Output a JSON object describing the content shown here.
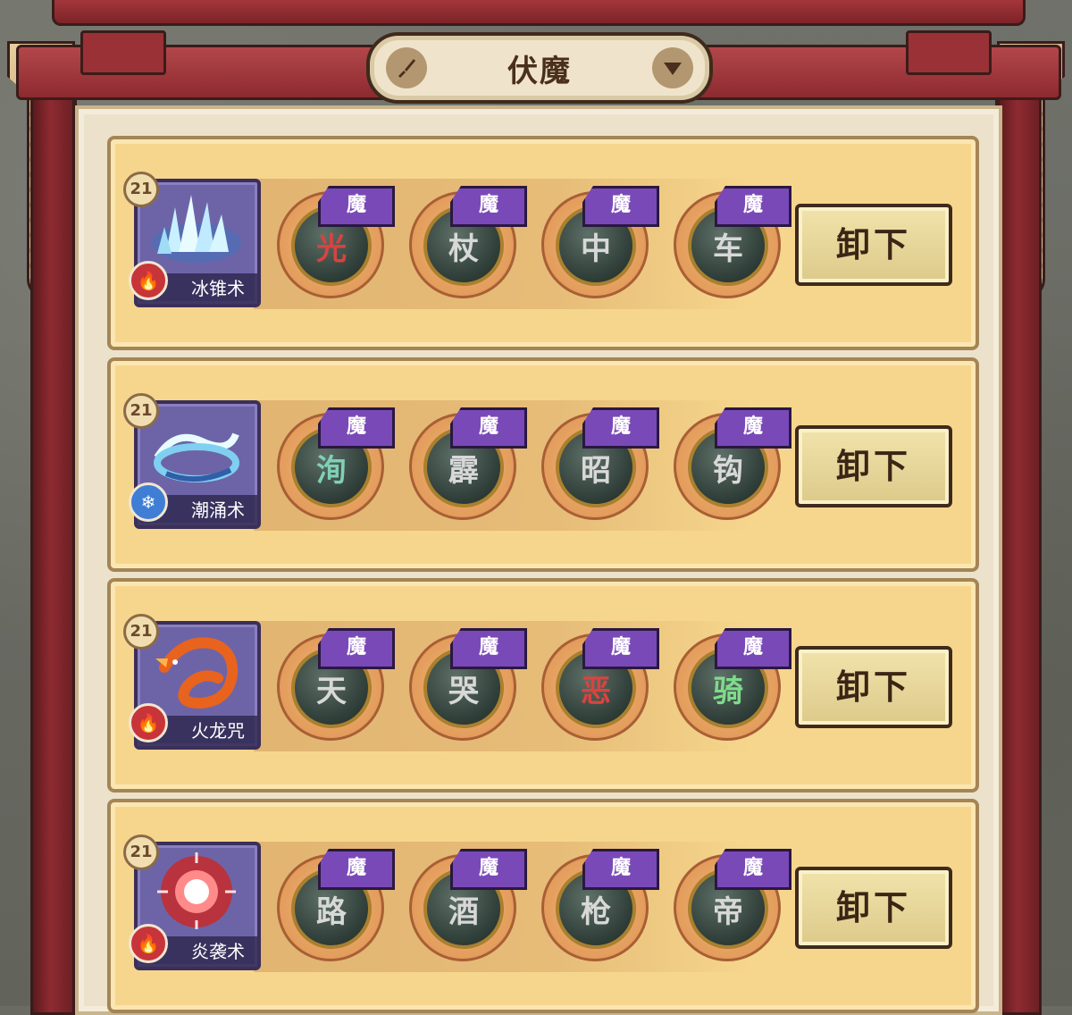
{
  "header": {
    "title": "伏魔",
    "left_icon": "brush-icon",
    "right_icon": "chevron-down-icon"
  },
  "rows": [
    {
      "skill": {
        "name": "冰锥术",
        "level": "21",
        "element": "fire",
        "art": "ice-spikes"
      },
      "runes": [
        {
          "tag": "魔",
          "char": "光",
          "color": "#d9433f"
        },
        {
          "tag": "魔",
          "char": "杖",
          "color": "#d8d8d8"
        },
        {
          "tag": "魔",
          "char": "中",
          "color": "#d8d8d8"
        },
        {
          "tag": "魔",
          "char": "车",
          "color": "#d8d8d8"
        }
      ],
      "button": "卸下"
    },
    {
      "skill": {
        "name": "潮涌术",
        "level": "21",
        "element": "ice",
        "art": "water-wave"
      },
      "runes": [
        {
          "tag": "魔",
          "char": "洵",
          "color": "#7fd1b6"
        },
        {
          "tag": "魔",
          "char": "霹",
          "color": "#d8d8d8"
        },
        {
          "tag": "魔",
          "char": "昭",
          "color": "#d8d8d8"
        },
        {
          "tag": "魔",
          "char": "钩",
          "color": "#d8d8d8"
        }
      ],
      "button": "卸下"
    },
    {
      "skill": {
        "name": "火龙咒",
        "level": "21",
        "element": "fire",
        "art": "fire-dragon"
      },
      "runes": [
        {
          "tag": "魔",
          "char": "天",
          "color": "#d8d8d8"
        },
        {
          "tag": "魔",
          "char": "哭",
          "color": "#d8d8d8"
        },
        {
          "tag": "魔",
          "char": "恶",
          "color": "#d9433f"
        },
        {
          "tag": "魔",
          "char": "骑",
          "color": "#7ddc8a"
        }
      ],
      "button": "卸下"
    },
    {
      "skill": {
        "name": "炎袭术",
        "level": "21",
        "element": "fire",
        "art": "fire-burst"
      },
      "runes": [
        {
          "tag": "魔",
          "char": "路",
          "color": "#d8d8d8"
        },
        {
          "tag": "魔",
          "char": "酒",
          "color": "#d8d8d8"
        },
        {
          "tag": "魔",
          "char": "枪",
          "color": "#d8d8d8"
        },
        {
          "tag": "魔",
          "char": "帝",
          "color": "#d8d8d8"
        }
      ],
      "button": "卸下"
    }
  ]
}
